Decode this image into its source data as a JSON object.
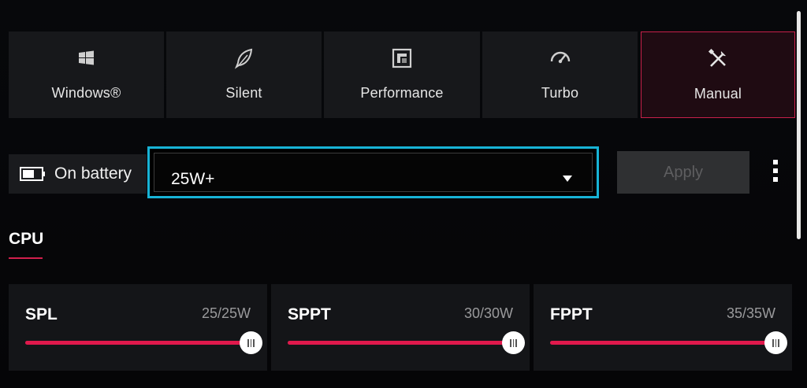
{
  "modes": [
    {
      "label": "Windows®",
      "icon": "windows-icon",
      "active": false
    },
    {
      "label": "Silent",
      "icon": "silent-leaf-icon",
      "active": false
    },
    {
      "label": "Performance",
      "icon": "performance-icon",
      "active": false
    },
    {
      "label": "Turbo",
      "icon": "turbo-gauge-icon",
      "active": false
    },
    {
      "label": "Manual",
      "icon": "manual-tools-icon",
      "active": true
    }
  ],
  "power": {
    "source_label": "On battery",
    "source_icon": "battery-icon",
    "profile_value": "25W+",
    "apply_label": "Apply",
    "apply_enabled": false
  },
  "section": {
    "title": "CPU"
  },
  "sliders": [
    {
      "name": "SPL",
      "readout": "25/25W",
      "value": 25,
      "max": 25
    },
    {
      "name": "SPPT",
      "readout": "30/30W",
      "value": 30,
      "max": 30
    },
    {
      "name": "FPPT",
      "readout": "35/35W",
      "value": 35,
      "max": 35
    }
  ],
  "colors": {
    "accent": "#e0194c",
    "focus": "#17b3d6",
    "active_border": "#c8204a"
  }
}
